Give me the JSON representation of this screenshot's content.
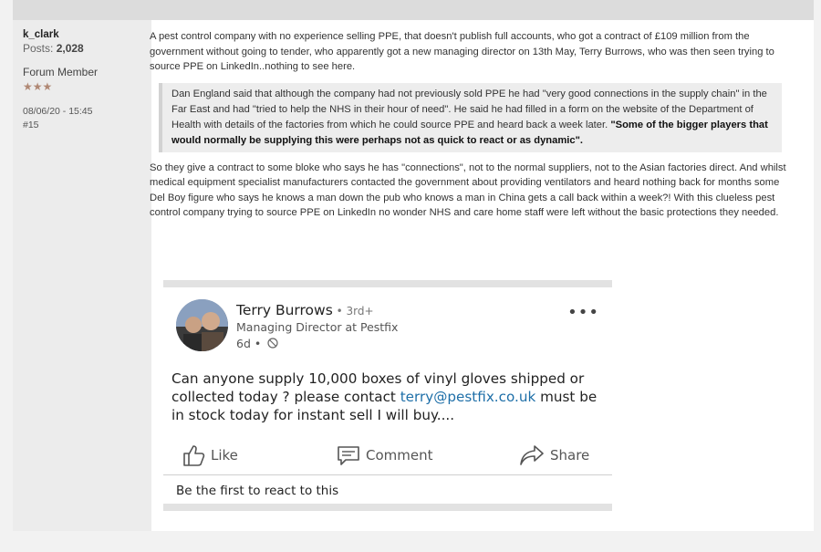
{
  "user": {
    "name": "k_clark",
    "posts_label": "Posts:",
    "posts_count": "2,028",
    "title": "Forum Member",
    "stars": "★★★",
    "date": "08/06/20 - 15:45",
    "post_number": "#15"
  },
  "post": {
    "paragraph1": "A pest control company with no experience selling PPE, that doesn't publish full accounts, who got a contract of £109 million from the government without going to tender, who apparently got a new managing director on 13th May, Terry Burrows, who was then seen trying to source PPE on LinkedIn..nothing to see here.",
    "quote_text": "Dan England said that although the company had not previously sold PPE he had \"very good connections in the supply chain\" in the Far East and had \"tried to help the NHS in their hour of need\". He said he had filled in a form on the website of the Department of Health with details of the factories from which he could source PPE and heard back a week later. ",
    "quote_bold": "\"Some of the bigger players that would normally be supplying this were perhaps not as quick to react or as dynamic\".",
    "paragraph2": "So they give a contract to some bloke who says he has \"connections\", not to the normal suppliers, not to the Asian factories direct. And whilst medical equipment specialist manufacturers contacted the government about providing ventilators and heard nothing back for months some Del Boy figure who says he knows a man down the pub who knows a man in China gets a call back within a week?! With this clueless pest control company trying to source PPE on LinkedIn no wonder NHS and care home staff were left without the basic protections they needed."
  },
  "linkedin": {
    "name": "Terry Burrows",
    "degree": " • 3rd+",
    "role": "Managing Director at Pestfix",
    "time": "6d •",
    "text_before": "Can anyone supply 10,000 boxes of vinyl gloves shipped or collected today ? please contact ",
    "email": "terry@pestfix.co.uk",
    "text_after": " must be in stock today for instant sell I will buy....",
    "like": "Like",
    "comment": "Comment",
    "share": "Share",
    "react_prompt": "Be the first to react to this"
  }
}
